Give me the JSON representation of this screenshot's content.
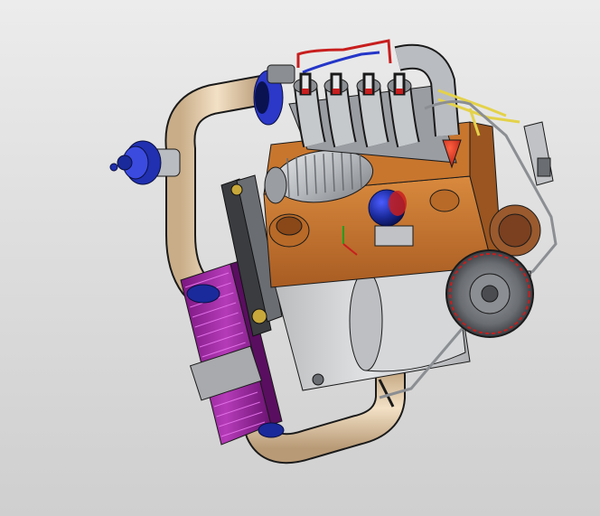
{
  "viewport": {
    "background_top": "#ececec",
    "background_bottom": "#cfcfcf"
  },
  "model": {
    "colors": {
      "block": "#c8762e",
      "block_dark": "#9a5520",
      "aluminum": "#b9bcc0",
      "aluminum_dark": "#8b8e92",
      "intake_pipe": "#e8cfae",
      "intercooler": "#8a1b8f",
      "intercooler_fins": "#b23bb5",
      "blow_off_valve": "#2030b0",
      "throttle_body": "#2b38c8",
      "oil_filter": "#1a2a9a",
      "fuel_lines": "#c81e1e",
      "fuel_lines_blue": "#2436c8",
      "wiring": "#e4d24a",
      "edges": "#1a1a1a",
      "gearbox": "#cfd1d3"
    },
    "icons": [
      "engine-model"
    ]
  }
}
